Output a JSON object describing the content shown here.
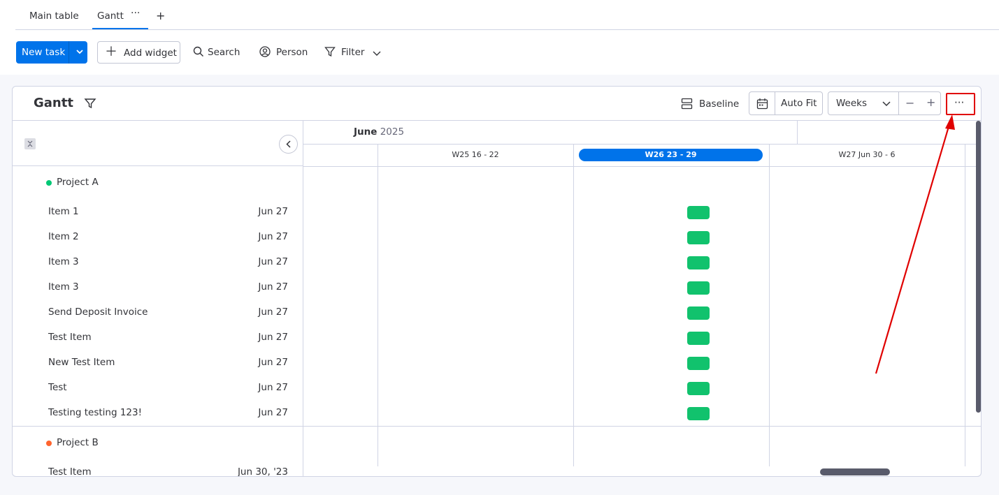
{
  "tabs": {
    "main_table": "Main table",
    "gantt": "Gantt",
    "more": "···",
    "add": "+"
  },
  "toolbar": {
    "new_task": "New task",
    "add_widget": "Add widget",
    "search": "Search",
    "person": "Person",
    "filter": "Filter"
  },
  "widget": {
    "title": "Gantt",
    "baseline": "Baseline",
    "auto_fit": "Auto Fit",
    "zoom_unit": "Weeks",
    "zoom_out": "−",
    "zoom_in": "+",
    "more": "···"
  },
  "timeline": {
    "month_bold": "June",
    "month_year": " 2025",
    "weeks": [
      "W25 16 - 22",
      "W26 23 - 29",
      "W27 Jun 30 - 6"
    ],
    "current_week": "W26 23 - 29"
  },
  "groups": [
    {
      "name": "Project A",
      "color": "#00c875",
      "items": [
        {
          "name": "Item 1",
          "date": "Jun 27"
        },
        {
          "name": "Item 2",
          "date": "Jun 27"
        },
        {
          "name": "Item 3",
          "date": "Jun 27"
        },
        {
          "name": "Item 3",
          "date": "Jun 27"
        },
        {
          "name": "Send Deposit Invoice",
          "date": "Jun 27"
        },
        {
          "name": "Test Item",
          "date": "Jun 27"
        },
        {
          "name": "New Test Item",
          "date": "Jun 27"
        },
        {
          "name": "Test",
          "date": "Jun 27"
        },
        {
          "name": "Testing testing 123!",
          "date": "Jun 27"
        }
      ]
    },
    {
      "name": "Project B",
      "color": "#ff642e",
      "items": [
        {
          "name": "Test Item",
          "date": "Jun 30, '23"
        }
      ]
    }
  ],
  "colors": {
    "primary": "#0073ea",
    "bar": "#11c26d",
    "annotation": "#e00000"
  }
}
